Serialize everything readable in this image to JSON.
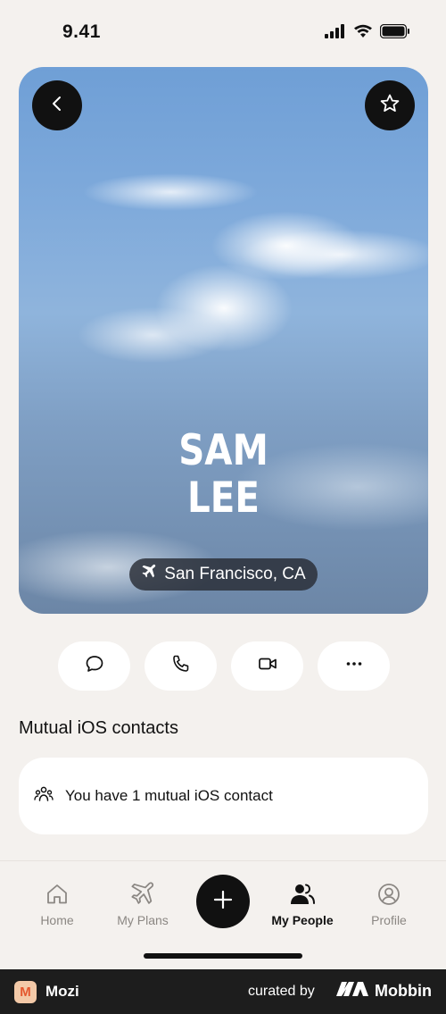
{
  "status_bar": {
    "time": "9.41"
  },
  "profile": {
    "first_name": "SAM",
    "last_name": "LEE",
    "location": "San Francisco, CA"
  },
  "hero_buttons": {
    "back_icon": "chevron-left-icon",
    "favorite_icon": "star-icon"
  },
  "actions": [
    {
      "name": "message",
      "icon": "chat-bubble-icon"
    },
    {
      "name": "call",
      "icon": "phone-icon"
    },
    {
      "name": "video",
      "icon": "video-camera-icon"
    },
    {
      "name": "more",
      "icon": "ellipsis-icon"
    }
  ],
  "mutual": {
    "title": "Mutual iOS contacts",
    "text": "You have 1 mutual iOS contact"
  },
  "tabs": [
    {
      "label": "Home",
      "icon": "home-icon",
      "active": false
    },
    {
      "label": "My Plans",
      "icon": "airplane-icon",
      "active": false
    },
    {
      "label": "My People",
      "icon": "people-icon",
      "active": true
    },
    {
      "label": "Profile",
      "icon": "user-circle-icon",
      "active": false
    }
  ],
  "footer": {
    "app_name": "Mozi",
    "curated_by": "curated by",
    "brand": "Mobbin"
  },
  "colors": {
    "background": "#f4f1ee",
    "dark": "#111111",
    "tab_inactive": "#8b8783",
    "footer_bg": "#1d1d1d"
  }
}
